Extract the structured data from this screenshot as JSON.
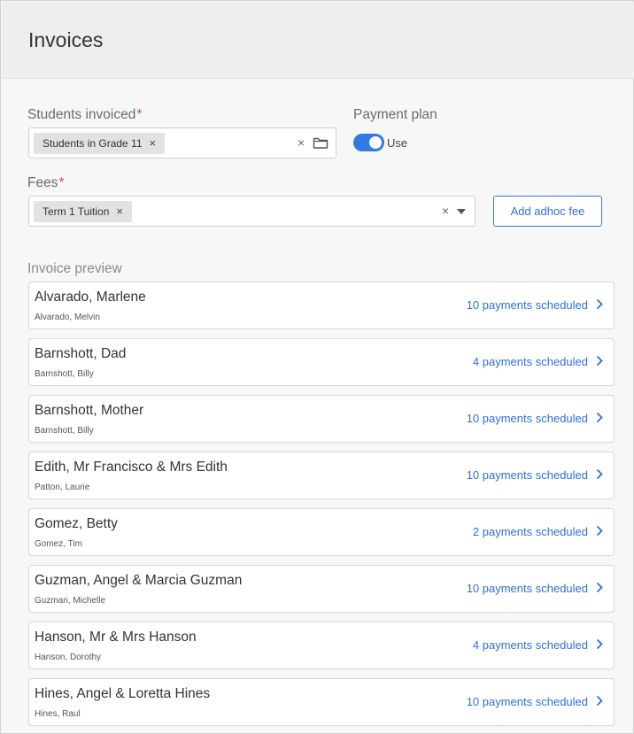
{
  "header": {
    "title": "Invoices"
  },
  "students": {
    "label": "Students invoiced",
    "required_mark": "*",
    "chip_label": "Students in Grade 11",
    "chip_remove": "×",
    "clear": "×"
  },
  "payment_plan": {
    "label": "Payment plan",
    "toggle_on": true,
    "toggle_label": "Use"
  },
  "fees": {
    "label": "Fees",
    "required_mark": "*",
    "chip_label": "Term 1 Tuition",
    "chip_remove": "×",
    "clear": "×"
  },
  "adhoc_button": {
    "label": "Add adhoc fee"
  },
  "preview": {
    "label": "Invoice preview",
    "rows": [
      {
        "name": "Alvarado, Marlene",
        "student": "Alvarado, Melvin",
        "status": "10 payments scheduled"
      },
      {
        "name": "Barnshott, Dad",
        "student": "Barnshott, Billy",
        "status": "4 payments scheduled"
      },
      {
        "name": "Barnshott, Mother",
        "student": "Barnshott, Billy",
        "status": "10 payments scheduled"
      },
      {
        "name": "Edith, Mr Francisco & Mrs Edith",
        "student": "Patton, Laurie",
        "status": "10 payments scheduled"
      },
      {
        "name": "Gomez, Betty",
        "student": "Gomez, Tim",
        "status": "2 payments scheduled"
      },
      {
        "name": "Guzman, Angel & Marcia Guzman",
        "student": "Guzman, Michelle",
        "status": "10 payments scheduled"
      },
      {
        "name": "Hanson, Mr & Mrs Hanson",
        "student": "Hanson, Dorothy",
        "status": "4 payments scheduled"
      },
      {
        "name": "Hines, Angel & Loretta Hines",
        "student": "Hines, Raul",
        "status": "10 payments scheduled"
      }
    ]
  },
  "colors": {
    "accent": "#2f7ae5",
    "required": "#e0464b",
    "link": "#2f6fd6"
  },
  "icons": {
    "folder": "folder-icon",
    "dropdown": "caret-down-icon",
    "row_arrow": "chevron-right-icon"
  }
}
